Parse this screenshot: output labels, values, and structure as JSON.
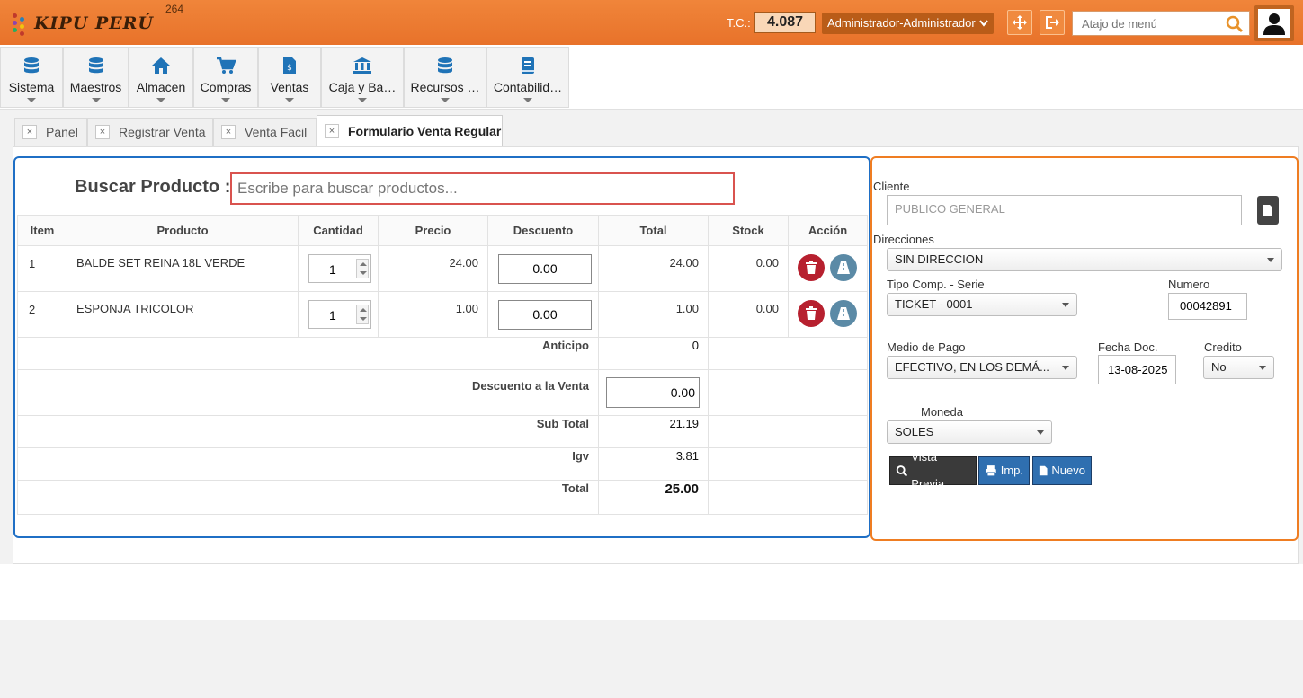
{
  "app": {
    "logo_text": "KIPU PERÚ",
    "build_number": "264",
    "tc_label": "T.C.:",
    "tc_value": "4.087",
    "user": "Administrador-Administrador",
    "menu_search_placeholder": "Atajo de menú"
  },
  "modules": [
    {
      "label": "Sistema",
      "icon": "database-icon"
    },
    {
      "label": "Maestros",
      "icon": "database-icon"
    },
    {
      "label": "Almacen",
      "icon": "home-icon"
    },
    {
      "label": "Compras",
      "icon": "cart-icon"
    },
    {
      "label": "Ventas",
      "icon": "invoice-icon"
    },
    {
      "label": "Caja y Ba…",
      "icon": "bank-icon"
    },
    {
      "label": "Recursos …",
      "icon": "database-icon"
    },
    {
      "label": "Contabilid…",
      "icon": "book-icon"
    }
  ],
  "tabs": [
    {
      "label": "Panel",
      "close": "×",
      "active": false
    },
    {
      "label": "Registrar Venta",
      "close": "×",
      "active": false
    },
    {
      "label": "Venta Facil",
      "close": "×",
      "active": false
    },
    {
      "label": "Formulario Venta Regular",
      "close": "×",
      "active": true
    }
  ],
  "search": {
    "label": "Buscar Producto :",
    "placeholder": "Escribe para buscar productos..."
  },
  "table": {
    "headers": [
      "Item",
      "Producto",
      "Cantidad",
      "Precio",
      "Descuento",
      "Total",
      "Stock",
      "Acción"
    ],
    "rows": [
      {
        "item": "1",
        "producto": "BALDE SET REINA 18L VERDE",
        "cantidad": "1",
        "precio": "24.00",
        "descuento": "0.00",
        "total": "24.00",
        "stock": "0.00"
      },
      {
        "item": "2",
        "producto": "ESPONJA TRICOLOR",
        "cantidad": "1",
        "precio": "1.00",
        "descuento": "0.00",
        "total": "1.00",
        "stock": "0.00"
      }
    ]
  },
  "summary": {
    "anticipo_label": "Anticipo",
    "anticipo": "0",
    "descuento_label": "Descuento a la Venta",
    "descuento": "0.00",
    "subtotal_label": "Sub Total",
    "subtotal": "21.19",
    "igv_label": "Igv",
    "igv": "3.81",
    "total_label": "Total",
    "total": "25.00"
  },
  "form": {
    "cliente_label": "Cliente",
    "cliente_placeholder": "PUBLICO GENERAL",
    "direcciones_label": "Direcciones",
    "direccion": "SIN DIRECCION",
    "tipo_label": "Tipo Comp. - Serie",
    "tipo": "TICKET - 0001",
    "numero_label": "Numero",
    "numero": "00042891",
    "medio_label": "Medio de Pago",
    "medio": "EFECTIVO, EN LOS DEMÁ...",
    "fecha_label": "Fecha Doc.",
    "fecha": "13-08-2025",
    "credito_label": "Credito",
    "credito": "No",
    "moneda_label": "Moneda",
    "moneda": "SOLES",
    "btn_preview": "Vista Previa",
    "btn_print": "Imp.",
    "btn_new": "Nuevo"
  },
  "colors": {
    "topbar": "#e8722a",
    "left_border": "#1f6fc5",
    "right_border": "#ef7d22",
    "delete": "#b7202f",
    "road": "#5b8aa6",
    "btn_dark": "#3a3a3a",
    "btn_blue": "#2f6fb0"
  }
}
